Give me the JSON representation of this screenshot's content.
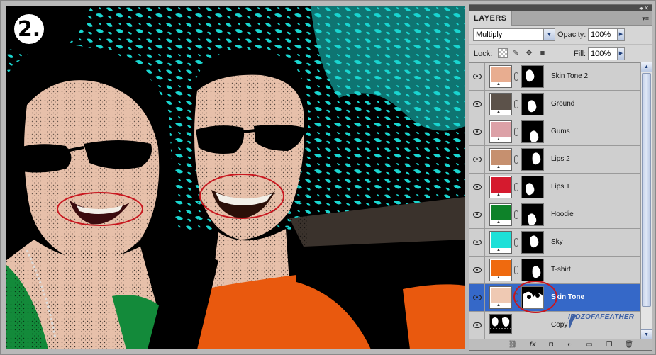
{
  "step": {
    "number": "2."
  },
  "panel": {
    "tab": "LAYERS",
    "blend_mode": "Multiply",
    "opacity_label": "Opacity:",
    "opacity_value": "100%",
    "lock_label": "Lock:",
    "fill_label": "Fill:",
    "fill_value": "100%"
  },
  "layers": [
    {
      "name": "Skin Tone 2",
      "color": "#e8ad90",
      "selected": false
    },
    {
      "name": "Ground",
      "color": "#5c524a",
      "selected": false
    },
    {
      "name": "Gums",
      "color": "#dca1a7",
      "selected": false
    },
    {
      "name": "Lips 2",
      "color": "#c6906f",
      "selected": false
    },
    {
      "name": "Lips 1",
      "color": "#d51a2e",
      "selected": false
    },
    {
      "name": "Hoodie",
      "color": "#0e8229",
      "selected": false
    },
    {
      "name": "Sky",
      "color": "#1ee0d8",
      "selected": false
    },
    {
      "name": "T-shirt",
      "color": "#ef6a0f",
      "selected": false
    },
    {
      "name": "Skin Tone",
      "color": "#efc9b3",
      "selected": true
    },
    {
      "name": "Copy",
      "color": "",
      "selected": false
    }
  ],
  "watermark": "IRDZOFAFEATHER",
  "colors": {
    "sky": "#1ad6d0",
    "skin": "#e7c0aa",
    "hoodie": "#138a3a",
    "tshirt": "#e9590e",
    "highlight": "#c8171f",
    "selection": "#3568c8"
  }
}
